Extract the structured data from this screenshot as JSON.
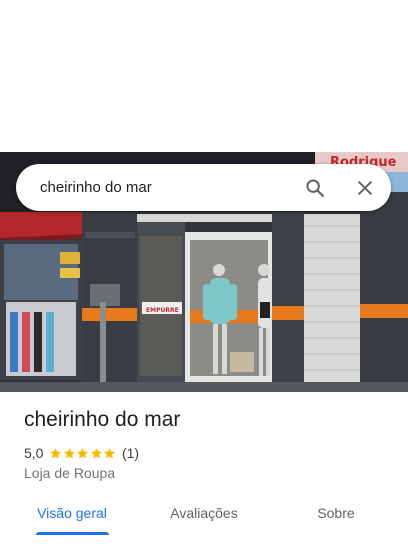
{
  "search": {
    "query": "cheirinho do mar",
    "search_icon": "search-icon",
    "close_icon": "close-icon"
  },
  "photo": {
    "sign_text": "Rodrigue",
    "door_sign": "EMPURRE"
  },
  "place": {
    "name": "cheirinho do mar",
    "rating": "5,0",
    "stars": 5,
    "review_count": "(1)",
    "category": "Loja de Roupa"
  },
  "tabs": [
    {
      "label": "Visão geral",
      "active": true
    },
    {
      "label": "Avaliações",
      "active": false
    },
    {
      "label": "Sobre",
      "active": false
    }
  ],
  "colors": {
    "accent": "#1a73e8",
    "star": "#fbbc04",
    "text_primary": "#202124",
    "text_secondary": "#70757a"
  }
}
